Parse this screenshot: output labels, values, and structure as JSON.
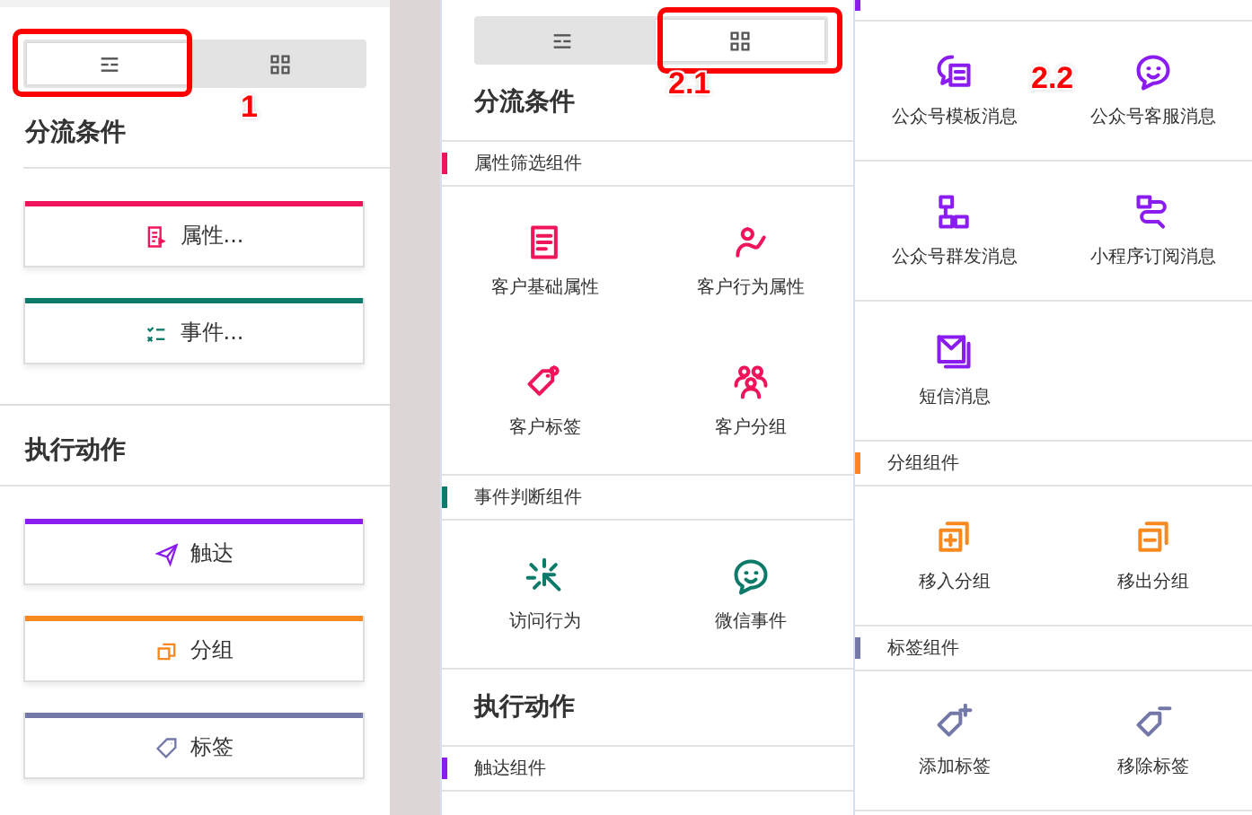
{
  "list_panel": {
    "view_toggle": [
      {
        "kind": "list",
        "selected": true
      },
      {
        "kind": "grid",
        "selected": false
      }
    ],
    "callout": "1",
    "sections": [
      {
        "title": "分流条件",
        "items": [
          {
            "label": "属性...",
            "color": "#f0145a",
            "kind": "form"
          },
          {
            "label": "事件...",
            "color": "#0e7a6a",
            "kind": "checklist"
          }
        ]
      },
      {
        "title": "执行动作",
        "items": [
          {
            "label": "触达",
            "color": "#8a1cf0",
            "kind": "send"
          },
          {
            "label": "分组",
            "color": "#f7891f",
            "kind": "group"
          },
          {
            "label": "标签",
            "color": "#7378a8",
            "kind": "tag"
          }
        ]
      }
    ]
  },
  "grid_panel": {
    "view_toggle": [
      {
        "kind": "list",
        "selected": false
      },
      {
        "kind": "grid",
        "selected": true
      }
    ],
    "callout": "2.1",
    "sections": [
      {
        "kind": "heading",
        "title": "分流条件"
      },
      {
        "kind": "group",
        "title": "属性筛选组件",
        "color": "#f0145a",
        "items": [
          {
            "label": "客户基础属性",
            "kind": "document"
          },
          {
            "label": "客户行为属性",
            "kind": "person-route"
          },
          {
            "label": "客户标签",
            "kind": "tag-pair"
          },
          {
            "label": "客户分组",
            "kind": "people"
          }
        ]
      },
      {
        "kind": "group",
        "title": "事件判断组件",
        "color": "#0e7a6a",
        "items": [
          {
            "label": "访问行为",
            "kind": "click"
          },
          {
            "label": "微信事件",
            "kind": "chat-face"
          }
        ]
      },
      {
        "kind": "heading",
        "title": "执行动作"
      },
      {
        "kind": "group",
        "title": "触达组件",
        "color": "#8a1cf0"
      }
    ]
  },
  "grid_panel_continued": {
    "callout": "2.2",
    "sections": [
      {
        "kind": "group",
        "color": "#8a1cf0",
        "items": [
          {
            "label": "公众号模板消息",
            "kind": "msg-template"
          },
          {
            "label": "公众号客服消息",
            "kind": "chat-face"
          },
          {
            "label": "公众号群发消息",
            "kind": "hierarchy"
          },
          {
            "label": "小程序订阅消息",
            "kind": "route"
          },
          {
            "label": "短信消息",
            "kind": "mail"
          }
        ]
      },
      {
        "kind": "group",
        "title": "分组组件",
        "color": "#f7891f",
        "items": [
          {
            "label": "移入分组",
            "kind": "group-add"
          },
          {
            "label": "移出分组",
            "kind": "group-remove"
          }
        ]
      },
      {
        "kind": "group",
        "title": "标签组件",
        "color": "#7378a8",
        "items": [
          {
            "label": "添加标签",
            "kind": "tag-add"
          },
          {
            "label": "移除标签",
            "kind": "tag-remove"
          }
        ]
      }
    ]
  }
}
